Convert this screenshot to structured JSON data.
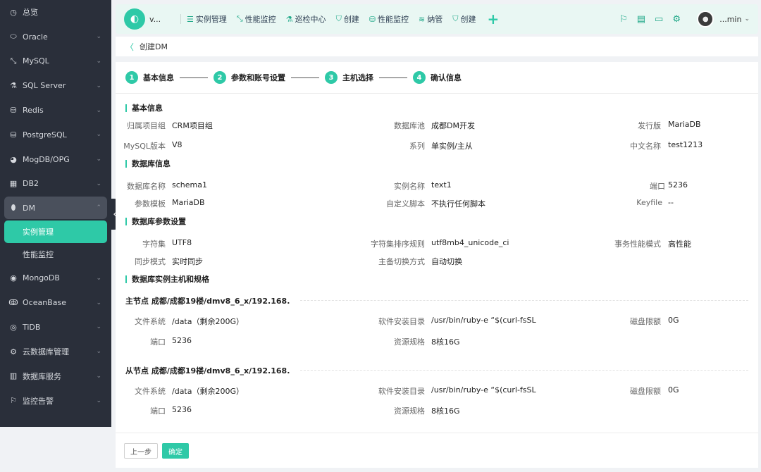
{
  "sidebar": {
    "items": [
      {
        "label": "总览",
        "icon": "clock-icon",
        "glyph": "◷",
        "chevron": false
      },
      {
        "label": "Oracle",
        "icon": "oracle-icon",
        "glyph": "⬭",
        "chevron": true
      },
      {
        "label": "MySQL",
        "icon": "mysql-icon",
        "glyph": "⤡",
        "chevron": true
      },
      {
        "label": "SQL Server",
        "icon": "sqlserver-icon",
        "glyph": "⚗",
        "chevron": true
      },
      {
        "label": "Redis",
        "icon": "redis-icon",
        "glyph": "⛁",
        "chevron": true
      },
      {
        "label": "PostgreSQL",
        "icon": "postgresql-icon",
        "glyph": "⛁",
        "chevron": true
      },
      {
        "label": "MogDB/OPG",
        "icon": "mogdb-icon",
        "glyph": "◕",
        "chevron": true
      },
      {
        "label": "DB2",
        "icon": "db2-icon",
        "glyph": "▦",
        "chevron": true
      }
    ],
    "dm": {
      "label": "DM",
      "icon": "dm-icon",
      "glyph": "⬮"
    },
    "dm_children": [
      {
        "label": "实例管理",
        "active": true
      },
      {
        "label": "性能监控",
        "active": false
      }
    ],
    "items_after": [
      {
        "label": "MongoDB",
        "icon": "mongodb-icon",
        "glyph": "◉",
        "chevron": true
      },
      {
        "label": "OceanBase",
        "icon": "oceanbase-icon",
        "glyph": "ↂ",
        "chevron": true
      },
      {
        "label": "TiDB",
        "icon": "tidb-icon",
        "glyph": "◎",
        "chevron": true
      },
      {
        "label": "云数据库管理",
        "icon": "cloud-db-icon",
        "glyph": "⚙",
        "chevron": true
      },
      {
        "label": "数据库服务",
        "icon": "db-service-icon",
        "glyph": "▥",
        "chevron": true
      },
      {
        "label": "监控告警",
        "icon": "alarm-icon",
        "glyph": "⚐",
        "chevron": true
      }
    ]
  },
  "header": {
    "logo_text": "v...",
    "nav": [
      {
        "label": "实例管理",
        "icon": "list-icon",
        "glyph": "☰"
      },
      {
        "label": "性能监控",
        "icon": "mysql-nav-icon",
        "glyph": "⤡"
      },
      {
        "label": "巡检中心",
        "icon": "inspect-icon",
        "glyph": "⚗"
      },
      {
        "label": "创建",
        "icon": "shield-icon",
        "glyph": "⛉"
      },
      {
        "label": "性能监控",
        "icon": "db-stack-icon",
        "glyph": "⛁"
      },
      {
        "label": "纳管",
        "icon": "layers-icon",
        "glyph": "≋"
      },
      {
        "label": "创建",
        "icon": "shield-icon",
        "glyph": "⛉"
      }
    ],
    "plus": "+",
    "tools": [
      {
        "icon": "alarm-icon",
        "glyph": "⚐"
      },
      {
        "icon": "clipboard-icon",
        "glyph": "▤"
      },
      {
        "icon": "monitor-icon",
        "glyph": "▭"
      },
      {
        "icon": "gear-icon",
        "glyph": "⚙"
      }
    ],
    "user": {
      "name": "...min",
      "caret": "⌄"
    }
  },
  "breadcrumb": {
    "back": "〈",
    "title": "创建DM"
  },
  "steps": [
    {
      "num": "1",
      "label": "基本信息"
    },
    {
      "num": "2",
      "label": "参数和账号设置"
    },
    {
      "num": "3",
      "label": "主机选择"
    },
    {
      "num": "4",
      "label": "确认信息"
    }
  ],
  "sections": {
    "basic": {
      "title": "基本信息",
      "fields": {
        "project_group": {
          "label": "归属项目组",
          "value": "CRM项目组"
        },
        "db_pool": {
          "label": "数据库池",
          "value": "成都DM开发"
        },
        "release": {
          "label": "发行版",
          "value": "MariaDB"
        },
        "mysql_version": {
          "label": "MySQL版本",
          "value": "V8"
        },
        "series": {
          "label": "系列",
          "value": "单实例/主从"
        },
        "cn_name": {
          "label": "中文名称",
          "value": "test1213"
        }
      }
    },
    "dbinfo": {
      "title": "数据库信息",
      "fields": {
        "db_name": {
          "label": "数据库名称",
          "value": "schema1"
        },
        "instance_name": {
          "label": "实例名称",
          "value": "text1"
        },
        "port": {
          "label": "端口",
          "value": "5236"
        },
        "param_template": {
          "label": "参数模板",
          "value": "MariaDB"
        },
        "custom_script": {
          "label": "自定义脚本",
          "value": "不执行任何脚本"
        },
        "keyfile": {
          "label": "Keyfile",
          "value": "--"
        }
      }
    },
    "params": {
      "title": "数据库参数设置",
      "fields": {
        "charset": {
          "label": "字符集",
          "value": "UTF8"
        },
        "collation": {
          "label": "字符集排序规则",
          "value": "utf8mb4_unicode_ci"
        },
        "tx_mode": {
          "label": "事务性能模式",
          "value": "高性能"
        },
        "sync_mode": {
          "label": "同步模式",
          "value": "实时同步"
        },
        "failover": {
          "label": "主备切换方式",
          "value": "自动切换"
        }
      }
    },
    "hosts": {
      "title": "数据库实例主机和规格",
      "master": {
        "title": "主节点   成都/成都19楼/dmv8_6_x/192.168.",
        "fs": {
          "label": "文件系统",
          "value": "/data（剩余200G）"
        },
        "install_dir": {
          "label": "软件安装目录",
          "value": "/usr/bin/ruby-e  “$(curl-fsSL"
        },
        "disk_quota": {
          "label": "磁盘限额",
          "value": "0G"
        },
        "port": {
          "label": "端口",
          "value": "5236"
        },
        "spec": {
          "label": "资源规格",
          "value": "8核16G"
        }
      },
      "slave": {
        "title": "从节点   成都/成都19楼/dmv8_6_x/192.168.",
        "fs": {
          "label": "文件系统",
          "value": "/data（剩余200G）"
        },
        "install_dir": {
          "label": "软件安装目录",
          "value": "/usr/bin/ruby-e  “$(curl-fsSL"
        },
        "disk_quota": {
          "label": "磁盘限额",
          "value": "0G"
        },
        "port": {
          "label": "端口",
          "value": "5236"
        },
        "spec": {
          "label": "资源规格",
          "value": "8核16G"
        }
      }
    }
  },
  "footer": {
    "prev_label": "上一步",
    "ok_label": "确定"
  },
  "colors": {
    "accent": "#2ec9a7",
    "sidebar_bg": "#2a2f3a",
    "header_bg": "#e9f7f3"
  }
}
